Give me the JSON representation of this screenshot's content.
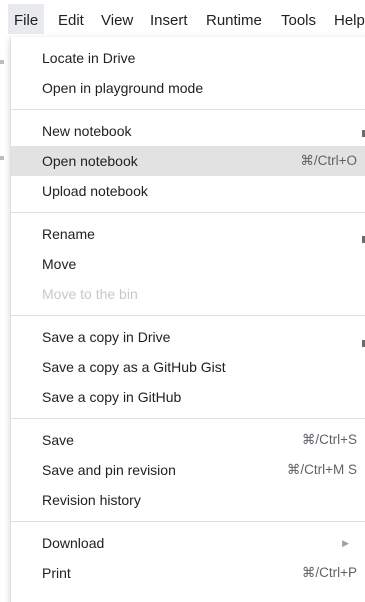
{
  "menubar": {
    "items": [
      "File",
      "Edit",
      "View",
      "Insert",
      "Runtime",
      "Tools",
      "Help"
    ]
  },
  "file_menu": {
    "sections": [
      {
        "items": [
          {
            "label": "Locate in Drive",
            "shortcut": ""
          },
          {
            "label": "Open in playground mode",
            "shortcut": ""
          }
        ]
      },
      {
        "items": [
          {
            "label": "New notebook",
            "shortcut": ""
          },
          {
            "label": "Open notebook",
            "shortcut": "⌘/Ctrl+O"
          },
          {
            "label": "Upload notebook",
            "shortcut": ""
          }
        ]
      },
      {
        "items": [
          {
            "label": "Rename",
            "shortcut": ""
          },
          {
            "label": "Move",
            "shortcut": ""
          },
          {
            "label": "Move to the bin",
            "shortcut": ""
          }
        ]
      },
      {
        "items": [
          {
            "label": "Save a copy in Drive",
            "shortcut": ""
          },
          {
            "label": "Save a copy as a GitHub Gist",
            "shortcut": ""
          },
          {
            "label": "Save a copy in GitHub",
            "shortcut": ""
          }
        ]
      },
      {
        "items": [
          {
            "label": "Save",
            "shortcut": "⌘/Ctrl+S"
          },
          {
            "label": "Save and pin revision",
            "shortcut": "⌘/Ctrl+M S"
          },
          {
            "label": "Revision history",
            "shortcut": ""
          }
        ]
      },
      {
        "items": [
          {
            "label": "Download",
            "shortcut": ""
          },
          {
            "label": "Print",
            "shortcut": "⌘/Ctrl+P"
          }
        ]
      }
    ],
    "highlighted_item": "Open notebook",
    "disabled_item": "Move to the bin",
    "submenu_arrow_icon": "triangle-right-icon"
  },
  "colors": {
    "highlight": "#e2e2e2",
    "active_menu_bg": "#e8eaed",
    "disabled_text": "#c8c8c8",
    "divider": "#e0e0e0"
  }
}
